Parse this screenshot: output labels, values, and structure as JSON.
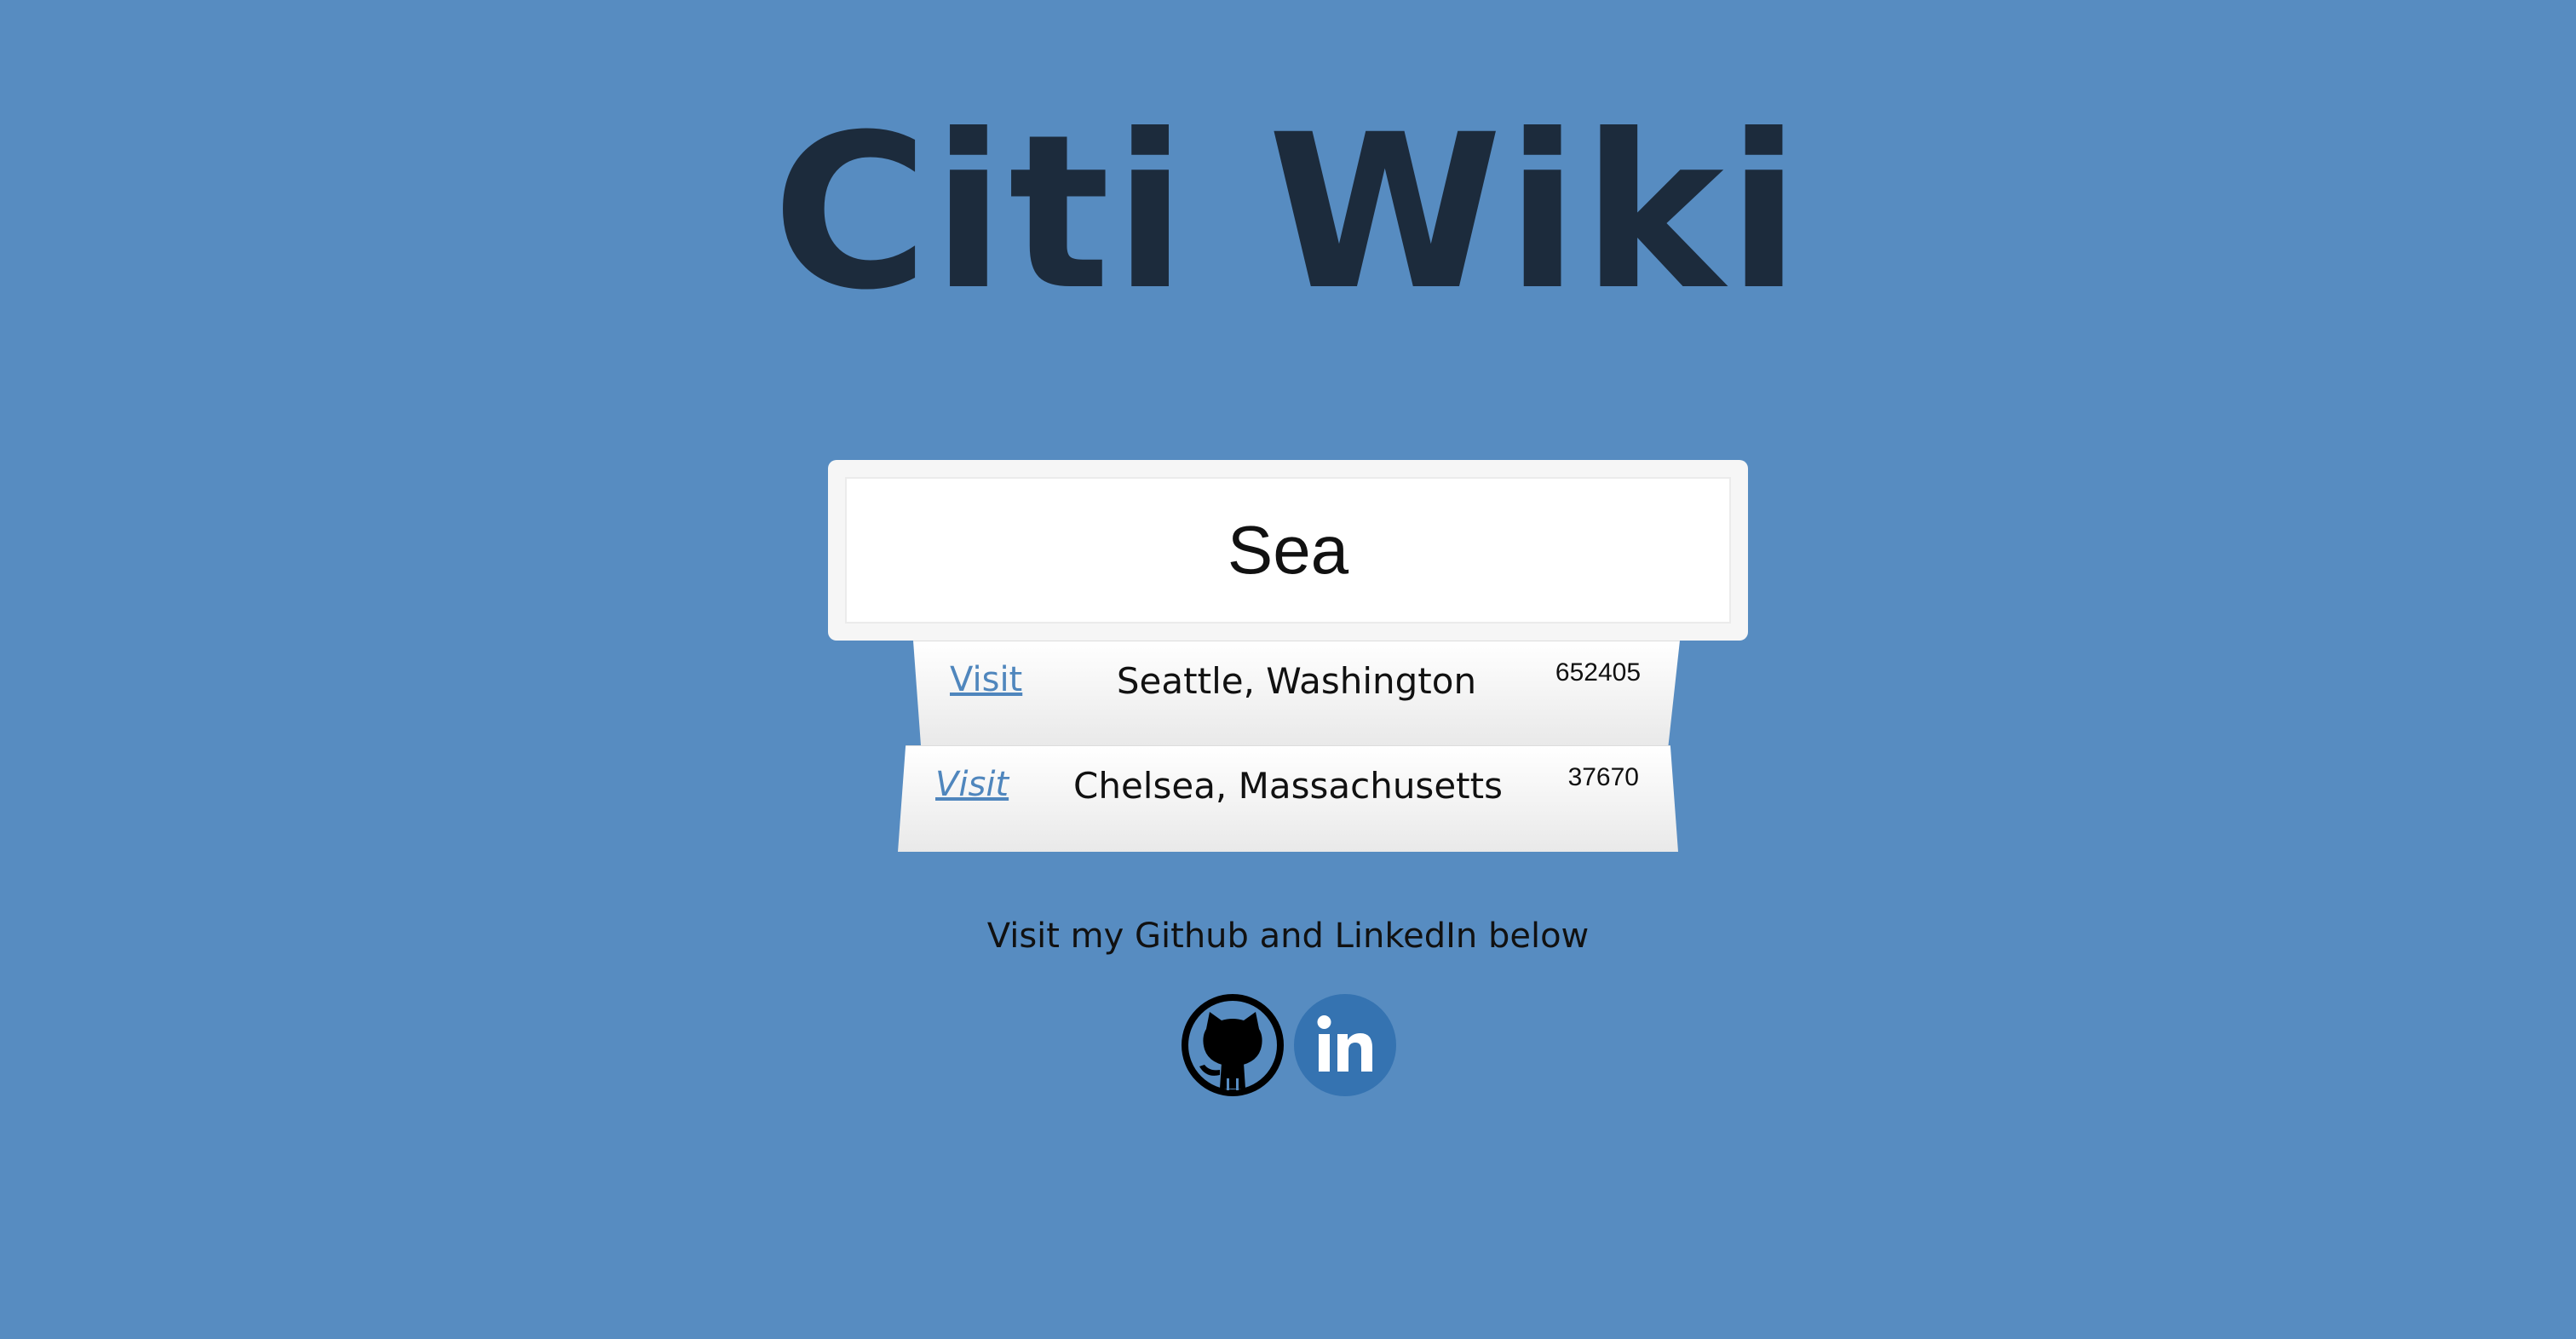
{
  "header": {
    "title": "Citi Wiki"
  },
  "search": {
    "value": "Sea"
  },
  "results": [
    {
      "link_label": "Visit",
      "city": "Seattle, Washington",
      "population": "652405"
    },
    {
      "link_label": "Visit",
      "city": "Chelsea, Massachusetts",
      "population": "37670"
    }
  ],
  "footer": {
    "text": "Visit my Github and LinkedIn below",
    "icons": [
      "github-icon",
      "linkedin-icon"
    ]
  },
  "colors": {
    "background": "#578cc1",
    "title": "#1c2b3c",
    "link": "#4f86bd",
    "linkedin": "#3573b1"
  }
}
